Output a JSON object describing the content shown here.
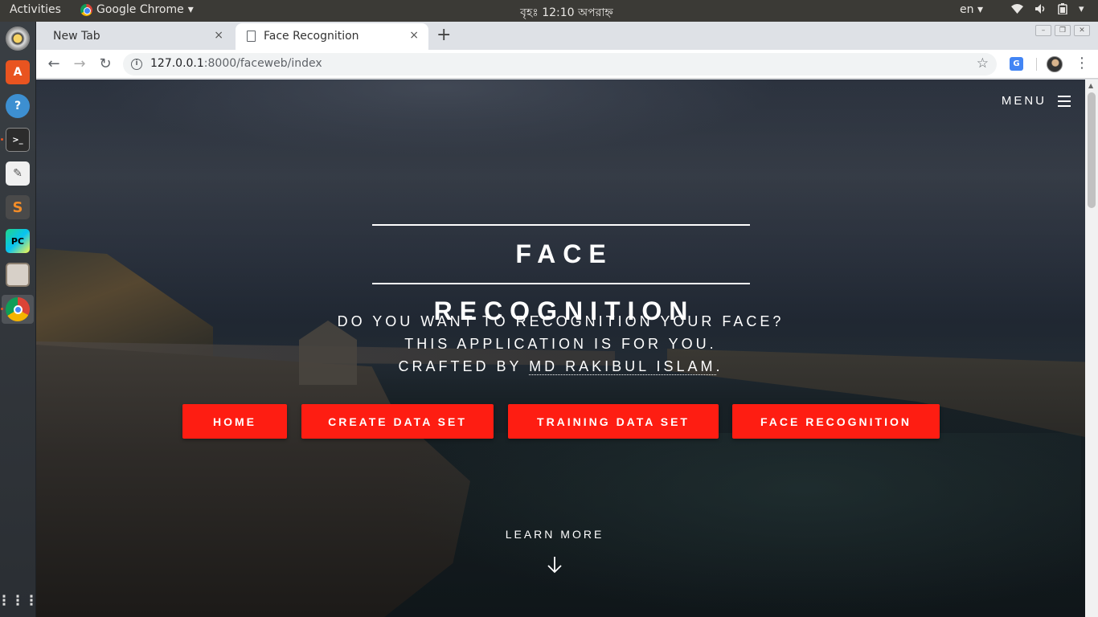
{
  "topbar": {
    "activities": "Activities",
    "app_name": "Google Chrome",
    "clock": "বৃহঃ 12:10 অপরাহ্ন",
    "language": "en",
    "dropdown_glyph": "▾"
  },
  "dock": {
    "items": [
      "rhythmbox",
      "ubuntu-software",
      "help",
      "terminal",
      "text-editor",
      "sublime-text",
      "pycharm",
      "files",
      "chrome",
      "show-applications"
    ]
  },
  "browser": {
    "tabs": [
      {
        "label": "New Tab",
        "active": false
      },
      {
        "label": "Face Recognition",
        "active": true
      }
    ],
    "close_glyph": "×",
    "new_tab_glyph": "+",
    "url_host": "127.0.0.1",
    "url_path": ":8000/faceweb/index",
    "icons": [
      "back-icon",
      "forward-icon",
      "reload-icon",
      "info-icon",
      "star-icon",
      "translate-icon",
      "profile-icon",
      "kebab-icon"
    ]
  },
  "page": {
    "menu_label": "MENU",
    "title": "FACE RECOGNITION",
    "subtitle_line1": "DO YOU WANT TO RECOGNITION YOUR FACE?",
    "subtitle_line2": "THIS APPLICATION IS FOR YOU.",
    "subtitle_line3_prefix": "CRAFTED BY ",
    "author": "MD RAKIBUL ISLAM",
    "subtitle_line3_suffix": ".",
    "buttons": [
      {
        "label": "HOME"
      },
      {
        "label": "CREATE DATA SET"
      },
      {
        "label": "TRAINING DATA SET"
      },
      {
        "label": "FACE RECOGNITION"
      }
    ],
    "learn_more": "LEARN MORE",
    "accent_color": "#fe1d12"
  }
}
